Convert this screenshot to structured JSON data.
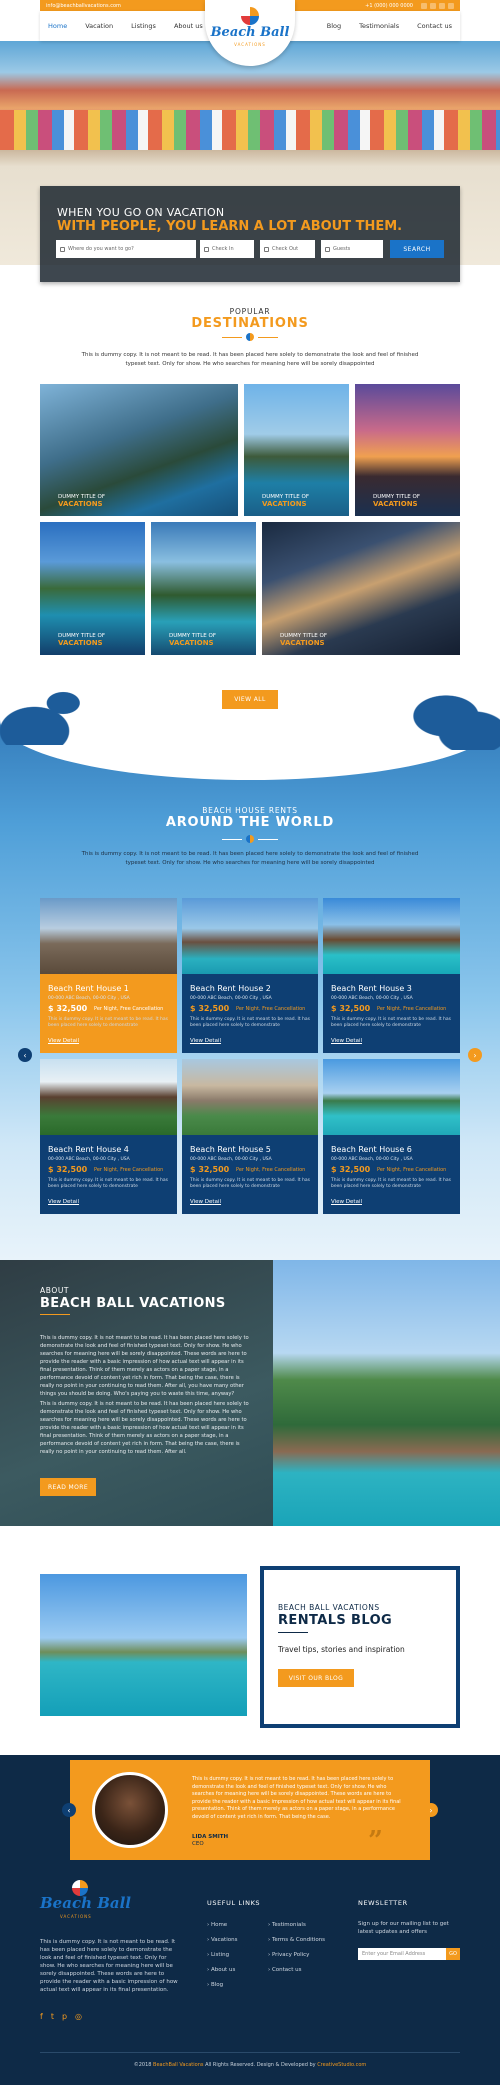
{
  "topbar": {
    "email": "info@beachballvacations.com",
    "phone": "+1 (000) 000 0000"
  },
  "nav": {
    "left": [
      "Home",
      "Vacation",
      "Listings",
      "About us"
    ],
    "right": [
      "Blog",
      "Testimonials",
      "Contact us"
    ]
  },
  "logo": {
    "name": "Beach Ball",
    "tag": "VACATIONS"
  },
  "hero": {
    "line1": "WHEN YOU GO ON VACATION",
    "line2": "WITH PEOPLE, YOU LEARN A LOT ABOUT THEM.",
    "where_placeholder": "Where do you want to go?",
    "checkin": "Check In",
    "checkout": "Check Out",
    "guests": "Guests",
    "search": "SEARCH"
  },
  "destinations": {
    "t1": "POPULAR",
    "t2": "DESTINATIONS",
    "para": "This is dummy copy. It is not meant to be read. It has been placed here solely to demonstrate the look and feel of finished typeset text. Only for show. He who searches for meaning here will be sorely disappointed",
    "tile_cap1": "DUMMY TITLE OF",
    "tile_cap2": "VACATIONS",
    "view_all": "VIEW ALL"
  },
  "rents": {
    "t1": "BEACH HOUSE RENTS",
    "t2": "AROUND THE WORLD",
    "para": "This is dummy copy. It is not meant to be read. It has been placed here solely to demonstrate the look and feel of finished typeset text. Only for show. He who searches for meaning here will be sorely disappointed",
    "cards": [
      {
        "title": "Beach Rent House 1",
        "address": "00-000 ABC Beach, 00-00 City , USA",
        "price": "$ 32,500",
        "per": "Per Night, Free Cancellation",
        "desc": "This is dummy copy. It is not meant to be read. It has been placed here solely to demonstrate",
        "view": "View Detail"
      },
      {
        "title": "Beach Rent House 2",
        "address": "00-000 ABC Beach, 00-00 City , USA",
        "price": "$ 32,500",
        "per": "Per Night, Free Cancellation",
        "desc": "This is dummy copy. It is not meant to be read. It has been placed here solely to demonstrate",
        "view": "View Detail"
      },
      {
        "title": "Beach Rent House 3",
        "address": "00-000 ABC Beach, 00-00 City , USA",
        "price": "$ 32,500",
        "per": "Per Night, Free Cancellation",
        "desc": "This is dummy copy. It is not meant to be read. It has been placed here solely to demonstrate",
        "view": "View Detail"
      },
      {
        "title": "Beach Rent House 4",
        "address": "00-000 ABC Beach, 00-00 City , USA",
        "price": "$ 32,500",
        "per": "Per Night, Free Cancellation",
        "desc": "This is dummy copy. It is not meant to be read. It has been placed here solely to demonstrate",
        "view": "View Detail"
      },
      {
        "title": "Beach Rent House 5",
        "address": "00-000 ABC Beach, 00-00 City , USA",
        "price": "$ 32,500",
        "per": "Per Night, Free Cancellation",
        "desc": "This is dummy copy. It is not meant to be read. It has been placed here solely to demonstrate",
        "view": "View Detail"
      },
      {
        "title": "Beach Rent House 6",
        "address": "00-000 ABC Beach, 00-00 City , USA",
        "price": "$ 32,500",
        "per": "Per Night, Free Cancellation",
        "desc": "This is dummy copy. It is not meant to be read. It has been placed here solely to demonstrate",
        "view": "View Detail"
      }
    ]
  },
  "about": {
    "t1": "ABOUT",
    "t2": "BEACH BALL VACATIONS",
    "p1": "This is dummy copy. It is not meant to be read. It has been placed here solely to demonstrate the look and feel of finished typeset text. Only for show. He who searches for meaning here will be sorely disappointed. These words are here to provide the reader with a basic impression of how actual text will appear in its final presentation. Think of them merely as actors on a paper stage, in a performance devoid of content yet rich in form. That being the case, there is really no point in your continuing to read them. After all, you have many other things you should be doing. Who's paying you to waste this time, anyway?",
    "p2": "This is dummy copy. It is not meant to be read. It has been placed here solely to demonstrate the look and feel of finished typeset text. Only for show. He who searches for meaning here will be sorely disappointed. These words are here to provide the reader with a basic impression of how actual text will appear in its final presentation. Think of them merely as actors on a paper stage, in a performance devoid of content yet rich in form. That being the case, there is really no point in your continuing to read them. After all.",
    "btn": "READ MORE"
  },
  "blog": {
    "t1": "BEACH BALL VACATIONS",
    "t2": "RENTALS BLOG",
    "sub": "Travel tips, stories and inspiration",
    "btn": "VISIT OUR BLOG"
  },
  "testimonial": {
    "text": "This is dummy copy. It is not meant to be read. It has been placed here solely to demonstrate the look and feel of finished typeset text. Only for show. He who searches for meaning here will be sorely disappointed. These words are here to provide the reader with a basic impression of how actual text will appear in its final presentation. Think of them merely as actors on a paper stage, in a performance devoid of content yet rich in form. That being the case.",
    "name": "LIDA SMITH",
    "role": "CEO"
  },
  "footer": {
    "about": "This is dummy copy. It is not meant to be read. It has been placed here solely to demonstrate the look and feel of finished typeset text. Only for show. He who searches for meaning here will be sorely disappointed. These words are here to provide the reader with a basic impression of how actual text will appear in its final presentation.",
    "useful": "USEFUL LINKS",
    "links1": [
      "Home",
      "Vacations",
      "Listing",
      "About us",
      "Blog"
    ],
    "links2": [
      "Testimonials",
      "Terms & Conditions",
      "Privacy Policy",
      "Contact us"
    ],
    "newsletter": "NEWSLETTER",
    "nl_text": "Sign up for our mailing list to get latest updates and offers",
    "nl_placeholder": "Enter your Email Address",
    "nl_btn": "GO",
    "copy_pre": "©2018",
    "copy_brand": "BeachBall Vacations",
    "copy_mid": "All Rights Reserved. Design & Developed by",
    "copy_dev": "CreativeStudio.com"
  }
}
